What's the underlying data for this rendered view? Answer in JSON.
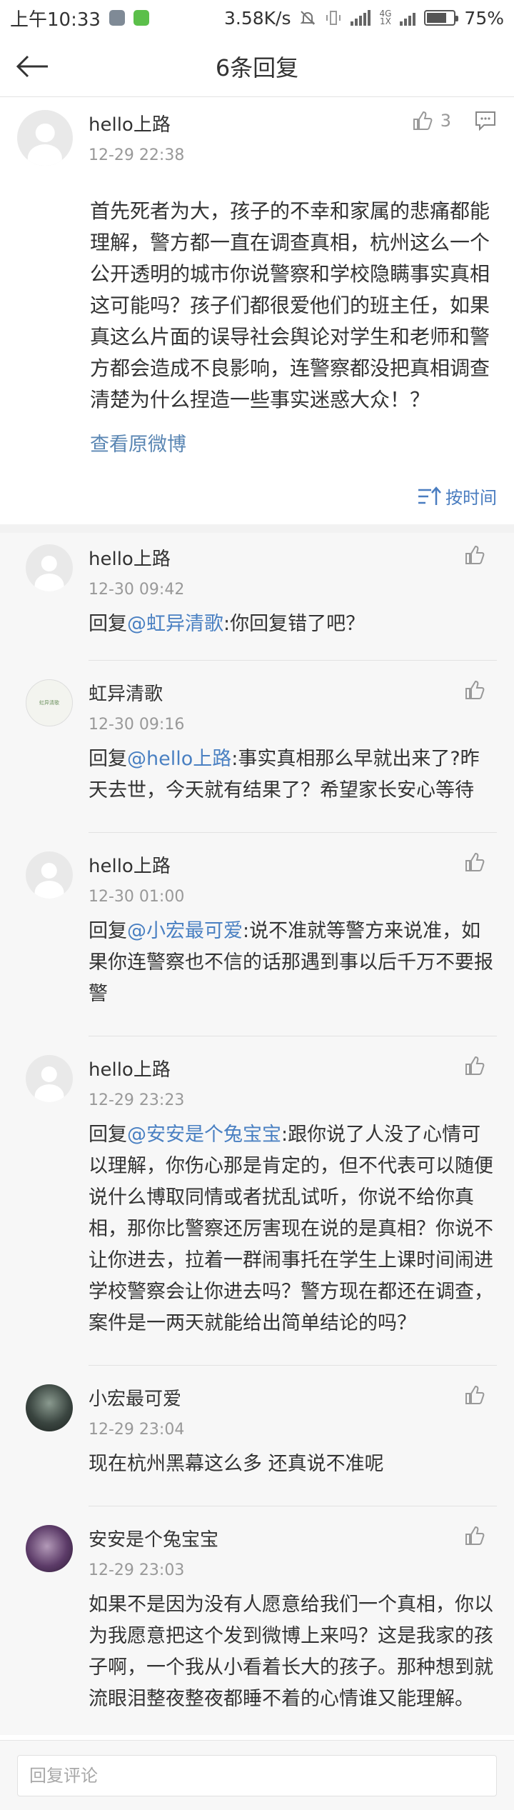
{
  "status": {
    "time": "上午10:33",
    "speed": "3.58K/s",
    "net_top": "4G",
    "net_bottom": "1X",
    "battery": "75%",
    "battery_level": 0.75
  },
  "nav": {
    "title": "6条回复"
  },
  "main": {
    "user": "hello上路",
    "time": "12-29 22:38",
    "likes": "3",
    "text": "首先死者为大，孩子的不幸和家属的悲痛都能理解，警方都一直在调查真相，杭州这么一个公开透明的城市你说警察和学校隐瞒事实真相这可能吗？孩子们都很爱他们的班主任，如果真这么片面的误导社会舆论对学生和老师和警方都会造成不良影响，连警察都没把真相调查清楚为什么捏造一些事实迷惑大众！？",
    "view_origin": "查看原微博",
    "sort_label": "按时间"
  },
  "replies": [
    {
      "user": "hello上路",
      "time": "12-30 09:42",
      "prefix": "回复",
      "mention": "@虹异清歌",
      "text": ":你回复错了吧？",
      "avatar_label": ""
    },
    {
      "user": "虹异清歌",
      "time": "12-30 09:16",
      "prefix": "回复",
      "mention": "@hello上路",
      "text": ":事实真相那么早就出来了?昨天去世，今天就有结果了？希望家长安心等待",
      "avatar_label": "虹异清歌"
    },
    {
      "user": "hello上路",
      "time": "12-30 01:00",
      "prefix": "回复",
      "mention": "@小宏最可爱",
      "text": ":说不准就等警方来说准，如果你连警察也不信的话那遇到事以后千万不要报警",
      "avatar_label": ""
    },
    {
      "user": "hello上路",
      "time": "12-29 23:23",
      "prefix": "回复",
      "mention": "@安安是个兔宝宝",
      "text": ":跟你说了人没了心情可以理解，你伤心那是肯定的，但不代表可以随便说什么博取同情或者扰乱试听，你说不给你真相，那你比警察还厉害现在说的是真相？你说不让你进去，拉着一群闹事托在学生上课时间闹进学校警察会让你进去吗？警方现在都还在调查，案件是一两天就能给出简单结论的吗？",
      "avatar_label": ""
    },
    {
      "user": "小宏最可爱",
      "time": "12-29 23:04",
      "prefix": "",
      "mention": "",
      "text": "现在杭州黑幕这么多 还真说不准呢",
      "avatar_label": ""
    },
    {
      "user": "安安是个兔宝宝",
      "time": "12-29 23:03",
      "prefix": "",
      "mention": "",
      "text": "如果不是因为没有人愿意给我们一个真相，你以为我愿意把这个发到微博上来吗？这是我家的孩子啊，一个我从小看着长大的孩子。那种想到就流眼泪整夜整夜都睡不着的心情谁又能理解。",
      "avatar_label": ""
    }
  ],
  "input": {
    "placeholder": "回复评论"
  }
}
